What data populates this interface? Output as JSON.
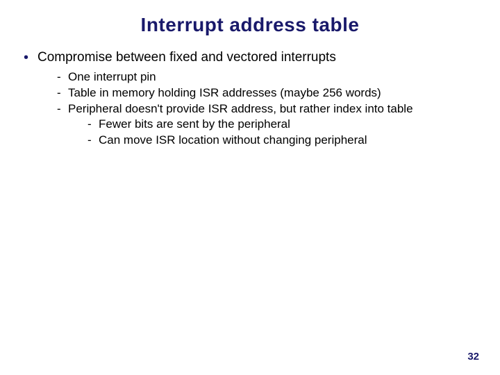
{
  "title": "Interrupt address table",
  "bullets": {
    "l1": {
      "item0": "Compromise between fixed and vectored interrupts"
    },
    "l2": {
      "item0": "One interrupt pin",
      "item1": "Table in memory holding ISR addresses (maybe 256 words)",
      "item2": "Peripheral doesn't provide ISR address, but rather index into table"
    },
    "l3": {
      "item0": "Fewer bits are sent by the peripheral",
      "item1": "Can move ISR location without changing peripheral"
    }
  },
  "page_number": "32"
}
